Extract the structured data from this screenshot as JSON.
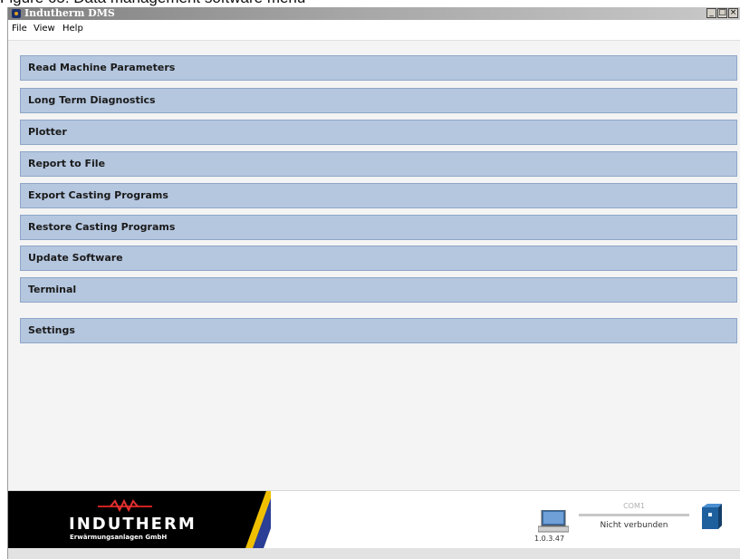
{
  "caption": "Figure 65: Data management software menu",
  "window": {
    "title": "Indutherm DMS",
    "controls": [
      "_",
      "□",
      "×"
    ]
  },
  "menu": [
    "File",
    "View",
    "Help"
  ],
  "nav_buttons": [
    "Read Machine Parameters",
    "Long Term Diagnostics",
    "Plotter",
    "Report to File",
    "Export Casting Programs",
    "Restore Casting Programs",
    "Update Software",
    "Terminal",
    "Settings"
  ],
  "footer": {
    "logo_name": "INDUTHERM",
    "logo_sub": "Erwärmungsanlagen GmbH",
    "version": "1.0.3.47",
    "port": "COM1",
    "connection_status": "Nicht verbunden"
  },
  "colors": {
    "button_bg": "#b5c7df",
    "button_border": "#8ea6c7",
    "logo_red": "#cc2020",
    "stripe_blue": "#2a3f95",
    "stripe_yellow": "#f0c000"
  },
  "icons": [
    "app-icon",
    "computer-icon",
    "device-icon"
  ]
}
